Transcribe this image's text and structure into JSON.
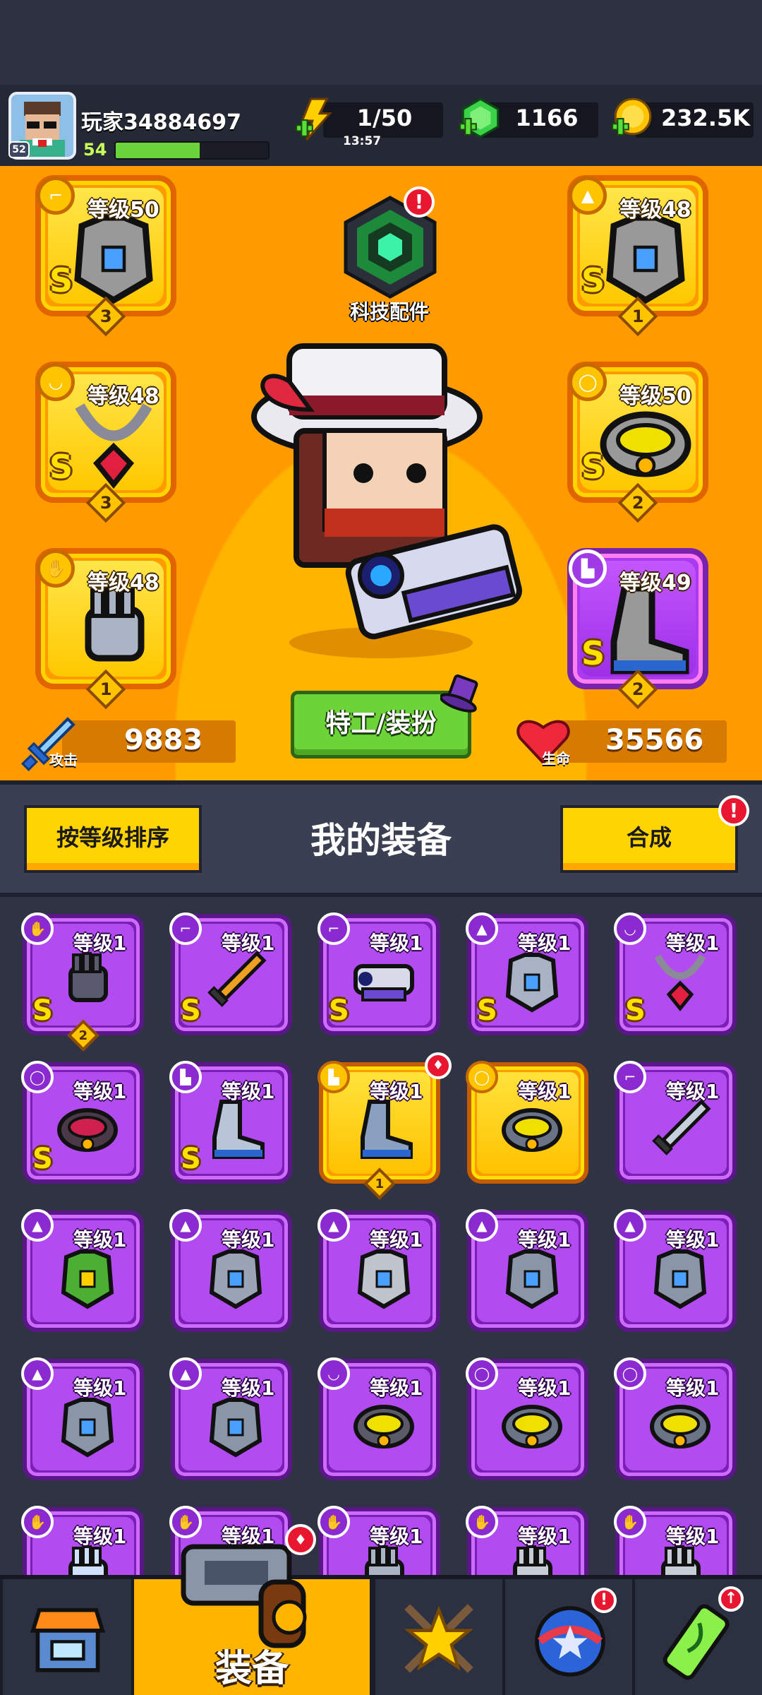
{
  "player": {
    "name": "玩家34884697",
    "level": "54",
    "avatar_badge": "52",
    "xp_fraction": 0.55
  },
  "resources": {
    "energy": "1/50",
    "energy_timer": "13:57",
    "gems": "1166",
    "coins": "232.5K"
  },
  "tech": {
    "label": "科技配件"
  },
  "equipped": [
    {
      "slot": "weapon",
      "level": "等级50",
      "grade": "S",
      "stars": "3",
      "rarity": "gold"
    },
    {
      "slot": "armor",
      "level": "等级48",
      "grade": "S",
      "stars": "1",
      "rarity": "gold"
    },
    {
      "slot": "necklace",
      "level": "等级48",
      "grade": "S",
      "stars": "3",
      "rarity": "gold"
    },
    {
      "slot": "belt",
      "level": "等级50",
      "grade": "S",
      "stars": "2",
      "rarity": "gold"
    },
    {
      "slot": "gloves",
      "level": "等级48",
      "grade": "",
      "stars": "1",
      "rarity": "gold"
    },
    {
      "slot": "boots",
      "level": "等级49",
      "grade": "S",
      "stars": "2",
      "rarity": "purple"
    }
  ],
  "agent_button": "特工/装扮",
  "stats": {
    "attack_label": "攻击",
    "attack": "9883",
    "hp_label": "生命",
    "hp": "35566"
  },
  "inventory": {
    "title": "我的装备",
    "sort_button": "按等级排序",
    "merge_button": "合成",
    "items": [
      {
        "level": "等级1",
        "grade": "S",
        "stars": "2",
        "rarity": "purple",
        "slot": "gloves",
        "art": "gloves-red"
      },
      {
        "level": "等级1",
        "grade": "S",
        "stars": "",
        "rarity": "purple",
        "slot": "weapon",
        "art": "sword"
      },
      {
        "level": "等级1",
        "grade": "S",
        "stars": "",
        "rarity": "purple",
        "slot": "weapon",
        "art": "gun"
      },
      {
        "level": "等级1",
        "grade": "S",
        "stars": "",
        "rarity": "purple",
        "slot": "armor",
        "art": "robot-armor"
      },
      {
        "level": "等级1",
        "grade": "S",
        "stars": "",
        "rarity": "purple",
        "slot": "necklace",
        "art": "necklace"
      },
      {
        "level": "等级1",
        "grade": "S",
        "stars": "",
        "rarity": "purple",
        "slot": "belt",
        "art": "belt-red"
      },
      {
        "level": "等级1",
        "grade": "S",
        "stars": "",
        "rarity": "purple",
        "slot": "boots",
        "art": "boots-gold"
      },
      {
        "level": "等级1",
        "grade": "",
        "stars": "1",
        "rarity": "gold",
        "slot": "boots",
        "art": "boots-blue"
      },
      {
        "level": "等级1",
        "grade": "",
        "stars": "",
        "rarity": "gold",
        "slot": "belt",
        "art": "belt-star"
      },
      {
        "level": "等级1",
        "grade": "",
        "stars": "",
        "rarity": "purple",
        "slot": "weapon",
        "art": "kunai"
      },
      {
        "level": "等级1",
        "grade": "",
        "stars": "",
        "rarity": "purple",
        "slot": "armor",
        "art": "leaf-armor"
      },
      {
        "level": "等级1",
        "grade": "",
        "stars": "",
        "rarity": "purple",
        "slot": "armor",
        "art": "plate-armor"
      },
      {
        "level": "等级1",
        "grade": "",
        "stars": "",
        "rarity": "purple",
        "slot": "armor",
        "art": "chest-armor"
      },
      {
        "level": "等级1",
        "grade": "",
        "stars": "",
        "rarity": "purple",
        "slot": "armor",
        "art": "steel-armor"
      },
      {
        "level": "等级1",
        "grade": "",
        "stars": "",
        "rarity": "purple",
        "slot": "armor",
        "art": "steel-armor"
      },
      {
        "level": "等级1",
        "grade": "",
        "stars": "",
        "rarity": "purple",
        "slot": "armor",
        "art": "steel-armor"
      },
      {
        "level": "等级1",
        "grade": "",
        "stars": "",
        "rarity": "purple",
        "slot": "armor",
        "art": "steel-armor"
      },
      {
        "level": "等级1",
        "grade": "",
        "stars": "",
        "rarity": "purple",
        "slot": "necklace",
        "art": "spike-ring"
      },
      {
        "level": "等级1",
        "grade": "",
        "stars": "",
        "rarity": "purple",
        "slot": "belt",
        "art": "belt-star"
      },
      {
        "level": "等级1",
        "grade": "",
        "stars": "",
        "rarity": "purple",
        "slot": "belt",
        "art": "belt-star"
      },
      {
        "level": "等级1",
        "grade": "",
        "stars": "",
        "rarity": "purple",
        "slot": "gloves",
        "art": "gloves-blue"
      },
      {
        "level": "等级1",
        "grade": "",
        "stars": "",
        "rarity": "purple",
        "slot": "gloves",
        "art": "gloves"
      },
      {
        "level": "等级1",
        "grade": "",
        "stars": "",
        "rarity": "purple",
        "slot": "gloves",
        "art": "gloves-green"
      },
      {
        "level": "等级1",
        "grade": "",
        "stars": "",
        "rarity": "purple",
        "slot": "gloves",
        "art": "gloves-gold"
      },
      {
        "level": "等级1",
        "grade": "",
        "stars": "",
        "rarity": "purple",
        "slot": "gloves",
        "art": "gloves-gold"
      }
    ]
  },
  "nav": {
    "active_label": "装备",
    "tabs": [
      "shop-icon",
      "equipment-icon",
      "battle-star-icon",
      "orb-icon",
      "dna-icon"
    ]
  },
  "colors": {
    "gold": "#ffc400",
    "purple": "#b24bf0",
    "orange_bg": "#ff9a00",
    "green_button": "#6cd438",
    "alert_red": "#e8172f"
  }
}
